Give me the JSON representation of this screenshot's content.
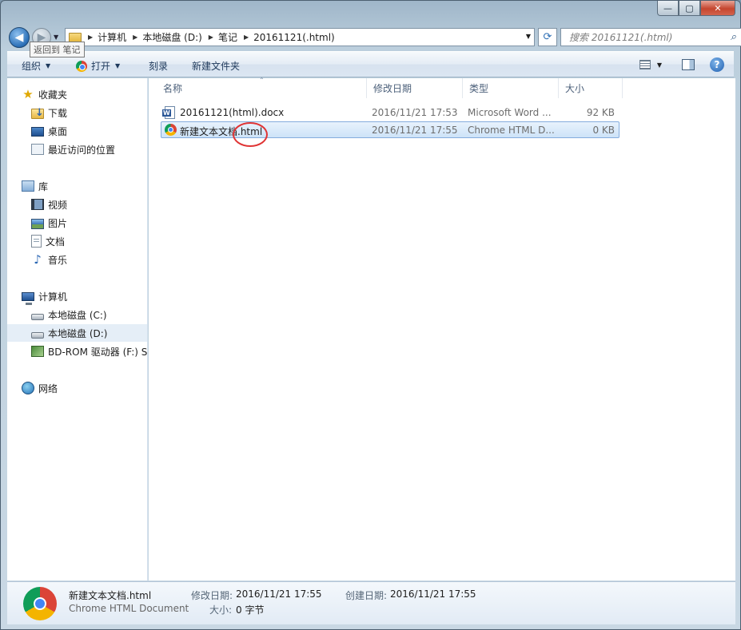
{
  "window": {
    "caption": {
      "minimize": "—",
      "maximize": "▢",
      "close": "✕"
    }
  },
  "nav": {
    "back_tooltip": "返回到 笔记",
    "back_symbol": "◀",
    "forward_symbol": "▶",
    "breadcrumb": [
      "计算机",
      "本地磁盘 (D:)",
      "笔记",
      "20161121(.html)"
    ],
    "refresh_symbol": "⟳",
    "search_placeholder": "搜索 20161121(.html)",
    "search_symbol": "⌕"
  },
  "toolbar": {
    "organize": "组织",
    "open": "打开",
    "burn": "刻录",
    "new_folder": "新建文件夹",
    "help_symbol": "?"
  },
  "sidebar": {
    "favorites": {
      "label": "收藏夹",
      "items": [
        {
          "label": "下载",
          "icon": "download-icon"
        },
        {
          "label": "桌面",
          "icon": "desktop-icon"
        },
        {
          "label": "最近访问的位置",
          "icon": "recent-places-icon"
        }
      ]
    },
    "libraries": {
      "label": "库",
      "items": [
        {
          "label": "视频",
          "icon": "video-icon"
        },
        {
          "label": "图片",
          "icon": "pictures-icon"
        },
        {
          "label": "文档",
          "icon": "documents-icon"
        },
        {
          "label": "音乐",
          "icon": "music-icon"
        }
      ]
    },
    "computer": {
      "label": "计算机",
      "items": [
        {
          "label": "本地磁盘 (C:)",
          "icon": "drive-c-icon"
        },
        {
          "label": "本地磁盘 (D:)",
          "icon": "drive-d-icon",
          "selected": true
        },
        {
          "label": "BD-ROM 驱动器 (F:) S",
          "icon": "bd-rom-icon"
        }
      ]
    },
    "network": {
      "label": "网络"
    }
  },
  "columns": [
    "名称",
    "修改日期",
    "类型",
    "大小"
  ],
  "files": [
    {
      "name": "20161121(html).docx",
      "modified": "2016/11/21 17:53",
      "type": "Microsoft Word ...",
      "size": "92 KB",
      "icon": "word-doc-icon",
      "selected": false
    },
    {
      "name": "新建文本文档.html",
      "modified": "2016/11/21 17:55",
      "type": "Chrome HTML D...",
      "size": "0 KB",
      "icon": "chrome-html-icon",
      "selected": true
    }
  ],
  "details": {
    "filename": "新建文本文档.html",
    "filetype": "Chrome HTML Document",
    "modified_label": "修改日期:",
    "modified_value": "2016/11/21 17:55",
    "created_label": "创建日期:",
    "created_value": "2016/11/21 17:55",
    "size_label": "大小:",
    "size_value": "0 字节"
  },
  "colors": {
    "selection_bg": "#cde3f8",
    "selection_border": "#84acdd",
    "annotation_circle": "#e03434"
  }
}
